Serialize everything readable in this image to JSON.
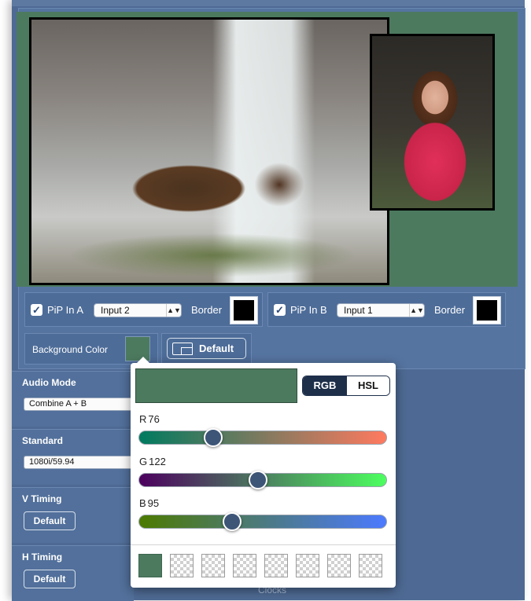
{
  "pip_a": {
    "checkbox_checked": true,
    "label": "PiP In A",
    "input_value": "Input 2",
    "border_label": "Border",
    "border_color": "#000000"
  },
  "pip_b": {
    "checkbox_checked": true,
    "label": "PiP In B",
    "input_value": "Input 1",
    "border_label": "Border",
    "border_color": "#000000"
  },
  "background": {
    "label": "Background Color",
    "color": "#4c7a5f"
  },
  "layout_default_label": "Default",
  "audio": {
    "label": "Audio Mode",
    "value": "Combine A + B"
  },
  "standard": {
    "label": "Standard",
    "value": "1080i/59.94"
  },
  "v_timing": {
    "label": "V Timing",
    "button": "Default"
  },
  "h_timing": {
    "label": "H Timing",
    "button": "Default"
  },
  "clocks_label": "Clocks",
  "color_picker": {
    "mode_rgb": "RGB",
    "mode_hsl": "HSL",
    "active_mode": "RGB",
    "current_color": "#4c7a5f",
    "r_label": "R",
    "r_value": "76",
    "g_label": "G",
    "g_value": "122",
    "b_label": "B",
    "b_value": "95",
    "r_fraction": 0.298,
    "g_fraction": 0.478,
    "b_fraction": 0.373,
    "presets": [
      "#4c7a5f",
      "empty",
      "empty",
      "empty",
      "empty",
      "empty",
      "empty",
      "empty"
    ]
  },
  "colors": {
    "window_bg": "#4e6a94",
    "pip_background": "#4c7a5f",
    "accent_dark": "#1e2f4a"
  }
}
